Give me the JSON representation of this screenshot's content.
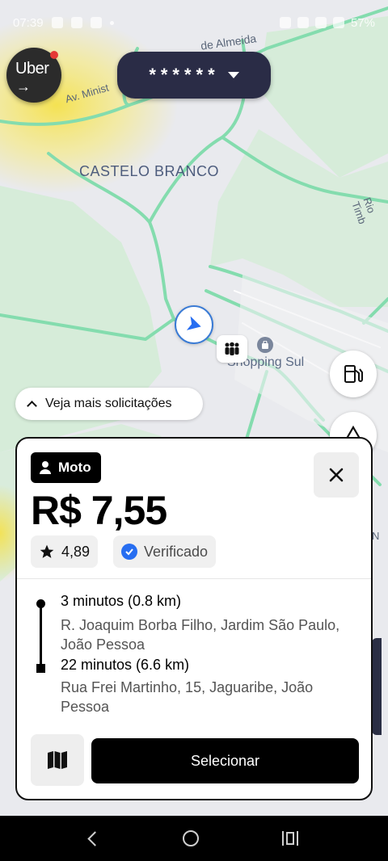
{
  "status_bar": {
    "time": "07:39",
    "battery": "57%"
  },
  "header": {
    "app_logo": "Uber",
    "earnings_masked": "******"
  },
  "map": {
    "labels": {
      "neighborhood": "CASTELO BRANCO",
      "mall": "Shopping Sul",
      "street_top": "de Almeida",
      "street_avenue": "Av. Minist",
      "river": "Rio Timb",
      "edge": "N"
    }
  },
  "more_requests": {
    "label": "Veja mais solicitações"
  },
  "request_card": {
    "product": "Moto",
    "price": "R$ 7,55",
    "rating": "4,89",
    "verified_label": "Verificado",
    "pickup": {
      "eta": "3 minutos (0.8 km)",
      "address": "R. Joaquim Borba Filho, Jardim São Paulo, João Pessoa"
    },
    "dropoff": {
      "eta": "22 minutos (6.6 km)",
      "address": "Rua Frei Martinho, 15, Jaguaribe, João Pessoa"
    },
    "select_label": "Selecionar"
  },
  "icons": [
    "uber-logo-icon",
    "caret-down-icon",
    "navigation-arrow-icon",
    "people-icon",
    "shopping-bag-icon",
    "fuel-icon",
    "safety-icon",
    "chevron-up-icon",
    "person-icon",
    "close-icon",
    "star-icon",
    "verified-check-icon",
    "map-icon",
    "back-icon",
    "home-icon",
    "recents-icon"
  ],
  "colors": {
    "accent_blue": "#276ef1",
    "road_green": "#7fd8a6",
    "surge_yellow": "#f5e14a",
    "pill_navy": "#2a2c46"
  }
}
